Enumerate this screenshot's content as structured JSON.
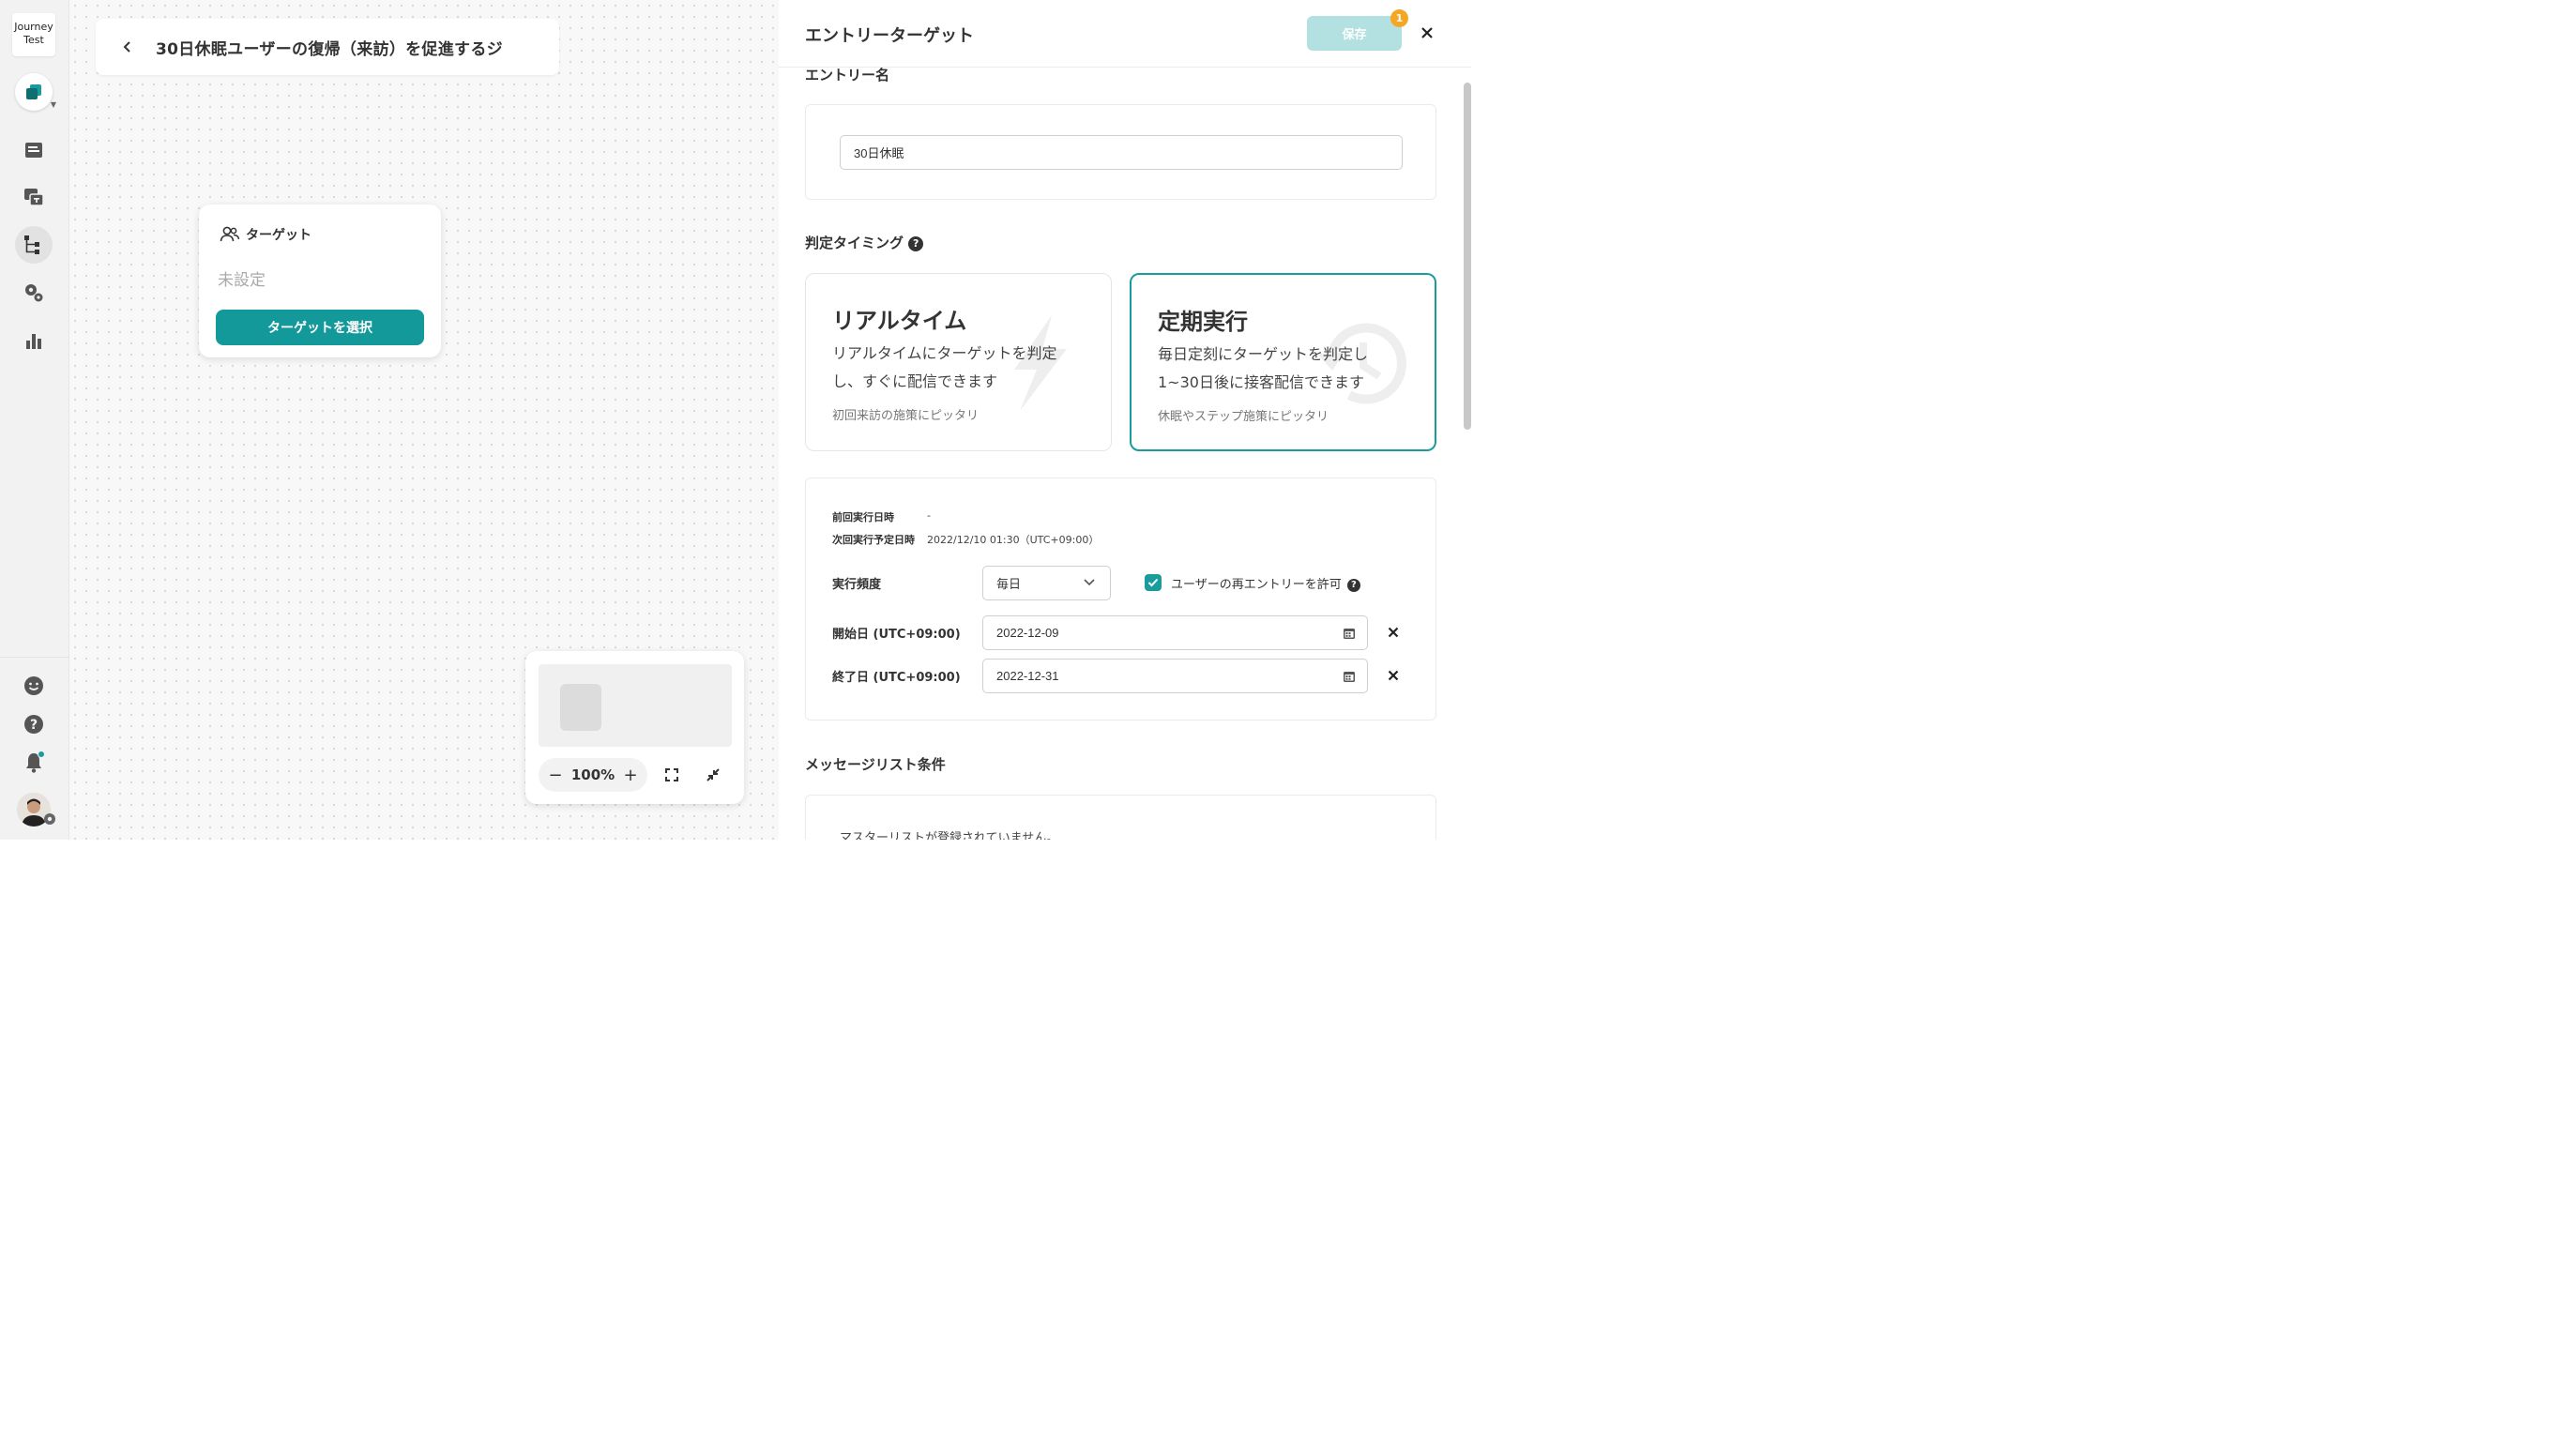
{
  "sidebar": {
    "brand_line1": "Journey",
    "brand_line2": "Test",
    "icons": [
      "app-switch-icon",
      "message-icon",
      "template-icon",
      "journey-icon",
      "settings-icon",
      "analytics-icon",
      "feedback-icon",
      "help-icon",
      "notification-icon"
    ]
  },
  "canvas": {
    "journey_title": "30日休眠ユーザーの復帰（来訪）を促進するジ",
    "target_node": {
      "header": "ターゲット",
      "status": "未設定",
      "button_label": "ターゲットを選択"
    },
    "minimap": {
      "zoom_minus": "−",
      "zoom_level": "100%",
      "zoom_plus": "+"
    }
  },
  "panel": {
    "title": "エントリーターゲット",
    "save_label": "保存",
    "save_badge": "1",
    "entry_name_label": "エントリー名",
    "entry_name_value": "30日休眠",
    "timing_label": "判定タイミング",
    "timing_options": [
      {
        "title": "リアルタイム",
        "desc": "リアルタイムにターゲットを判定し、すぐに配信できます",
        "note": "初回来訪の施策にピッタリ",
        "selected": false
      },
      {
        "title": "定期実行",
        "desc": "毎日定刻にターゲットを判定し1~30日後に接客配信できます",
        "note": "休眠やステップ施策にピッタリ",
        "selected": true
      }
    ],
    "schedule": {
      "last_run_label": "前回実行日時",
      "last_run_value": "-",
      "next_run_label": "次回実行予定日時",
      "next_run_value": "2022/12/10 01:30（UTC+09:00）",
      "frequency_label": "実行頻度",
      "frequency_value": "毎日",
      "reentry_label": "ユーザーの再エントリーを許可",
      "reentry_checked": true,
      "start_label": "開始日 (UTC+09:00)",
      "start_value": "2022-12-09",
      "end_label": "終了日 (UTC+09:00)",
      "end_value": "2022-12-31"
    },
    "message_list_label": "メッセージリスト条件",
    "message_list_note": "マスターリストが登録されていません。"
  },
  "colors": {
    "accent": "#14999a",
    "save_disabled": "#b3e0e0",
    "badge": "#f5a623"
  }
}
